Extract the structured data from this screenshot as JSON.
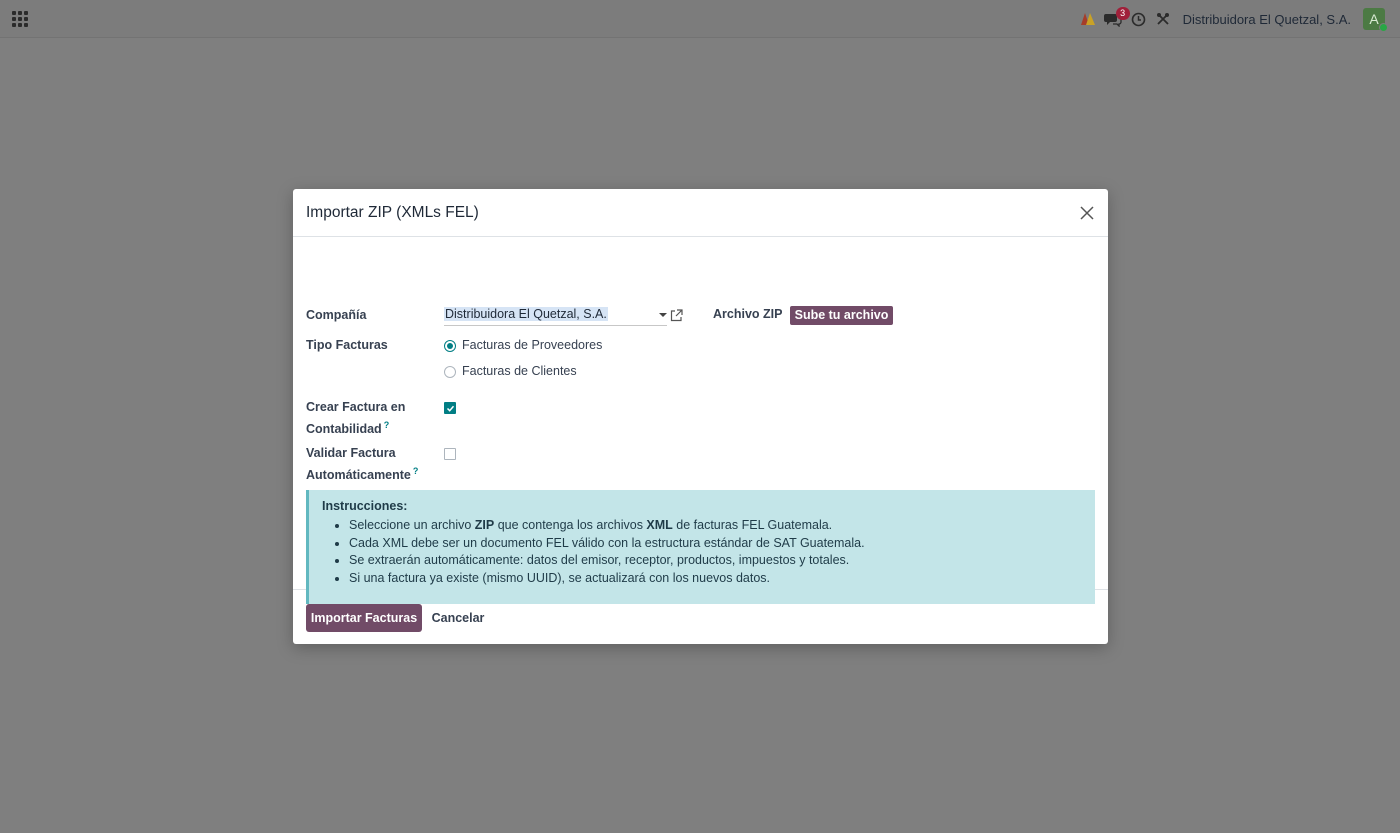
{
  "topbar": {
    "chat_count": "3",
    "company_name": "Distribuidora El Quetzal, S.A.",
    "avatar_initial": "A"
  },
  "modal": {
    "title": "Importar ZIP (XMLs FEL)",
    "fields": {
      "company_label": "Compañía",
      "company_value": "Distribuidora El Quetzal, S.A.",
      "zip_label": "Archivo ZIP",
      "upload_button": "Sube tu archivo",
      "invoice_type_label": "Tipo Facturas",
      "invoice_type_options": [
        "Facturas de Proveedores",
        "Facturas de Clientes"
      ],
      "invoice_type_selected": "Facturas de Proveedores",
      "create_invoice_label": "Crear Factura en Contabilidad",
      "create_invoice_checked": true,
      "validate_invoice_label": "Validar Factura Automáticamente",
      "validate_invoice_checked": false,
      "help_mark": "?"
    },
    "instructions": {
      "title": "Instrucciones:",
      "items": [
        {
          "pre": "Seleccione un archivo ",
          "b1": "ZIP",
          "mid": " que contenga los archivos ",
          "b2": "XML",
          "post": " de facturas FEL Guatemala."
        },
        "Cada XML debe ser un documento FEL válido con la estructura estándar de SAT Guatemala.",
        "Se extraerán automáticamente: datos del emisor, receptor, productos, impuestos y totales.",
        "Si una factura ya existe (mismo UUID), se actualizará con los nuevos datos."
      ]
    },
    "footer": {
      "import_button": "Importar Facturas",
      "cancel_button": "Cancelar"
    }
  },
  "colors": {
    "primary": "#714b67",
    "teal": "#017e84",
    "info_bg": "#c3e5e8",
    "overlay": "#7f7f7f"
  }
}
